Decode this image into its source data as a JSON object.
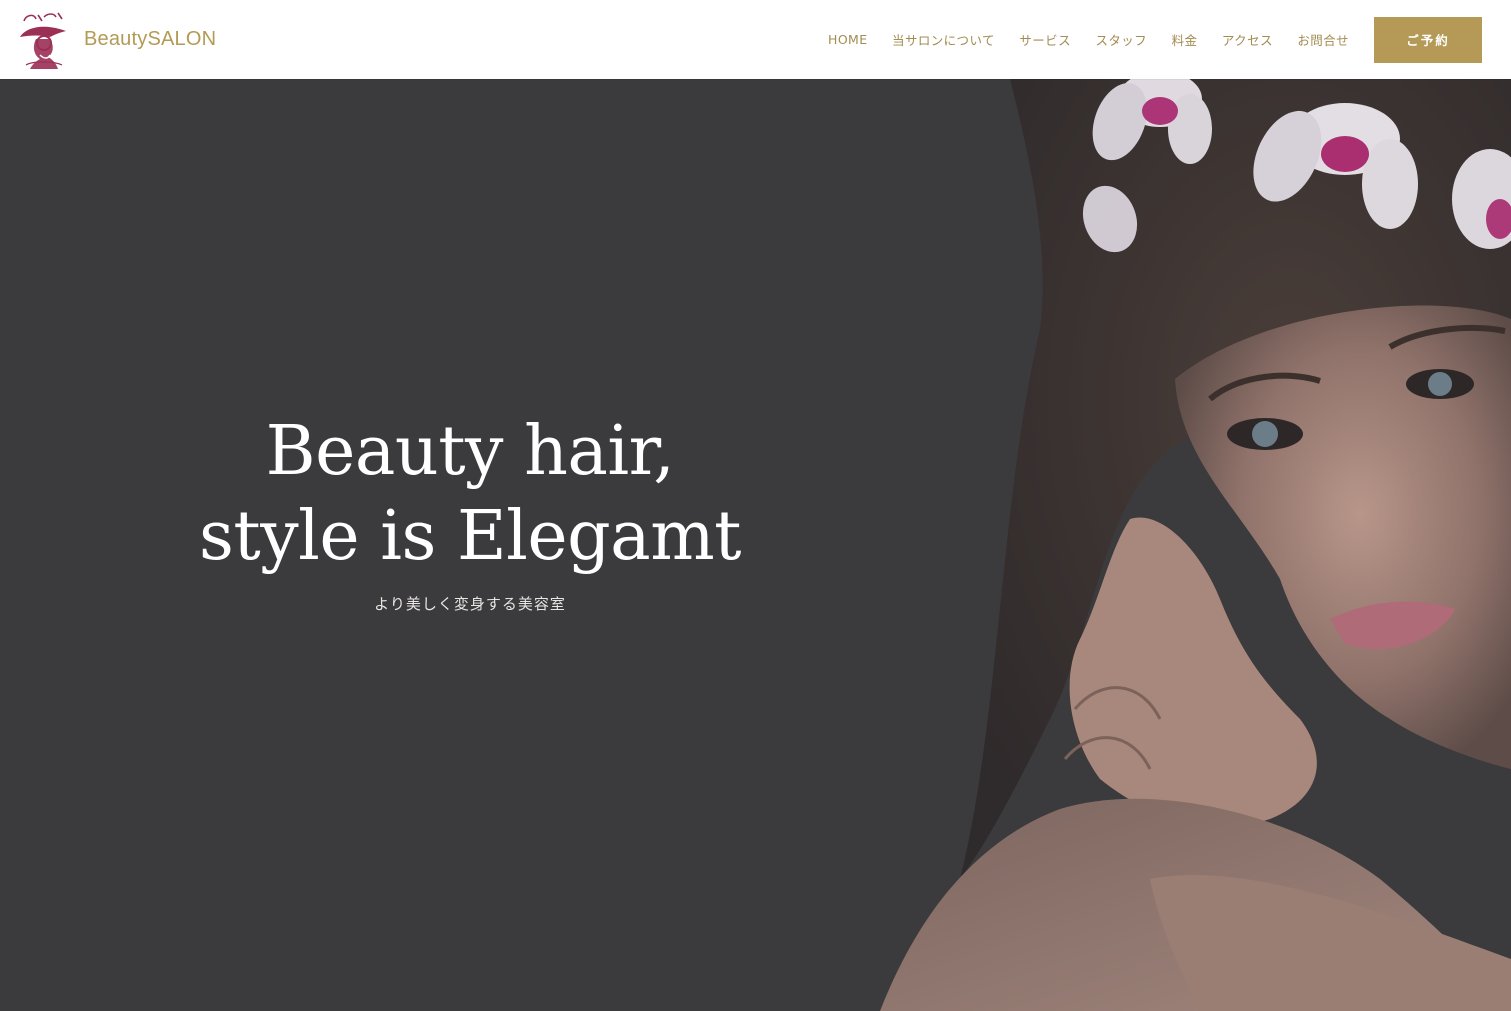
{
  "site": {
    "brand_name": "BeautySALON",
    "logo_text": "Beauty Salon"
  },
  "nav": {
    "items": [
      {
        "label": "HOME"
      },
      {
        "label": "当サロンについて"
      },
      {
        "label": "サービス"
      },
      {
        "label": "スタッフ"
      },
      {
        "label": "料金"
      },
      {
        "label": "アクセス"
      },
      {
        "label": "お問合せ"
      }
    ],
    "reserve_label": "ご予約"
  },
  "hero": {
    "title_line1": "Beauty hair,",
    "title_line2": "style is Elegamt",
    "subtitle": "より美しく変身する美容室"
  },
  "colors": {
    "accent": "#b49a56",
    "nav_text": "#a38c52",
    "logo": "#9b2f55",
    "hero_bg": "#3b3a3c"
  }
}
